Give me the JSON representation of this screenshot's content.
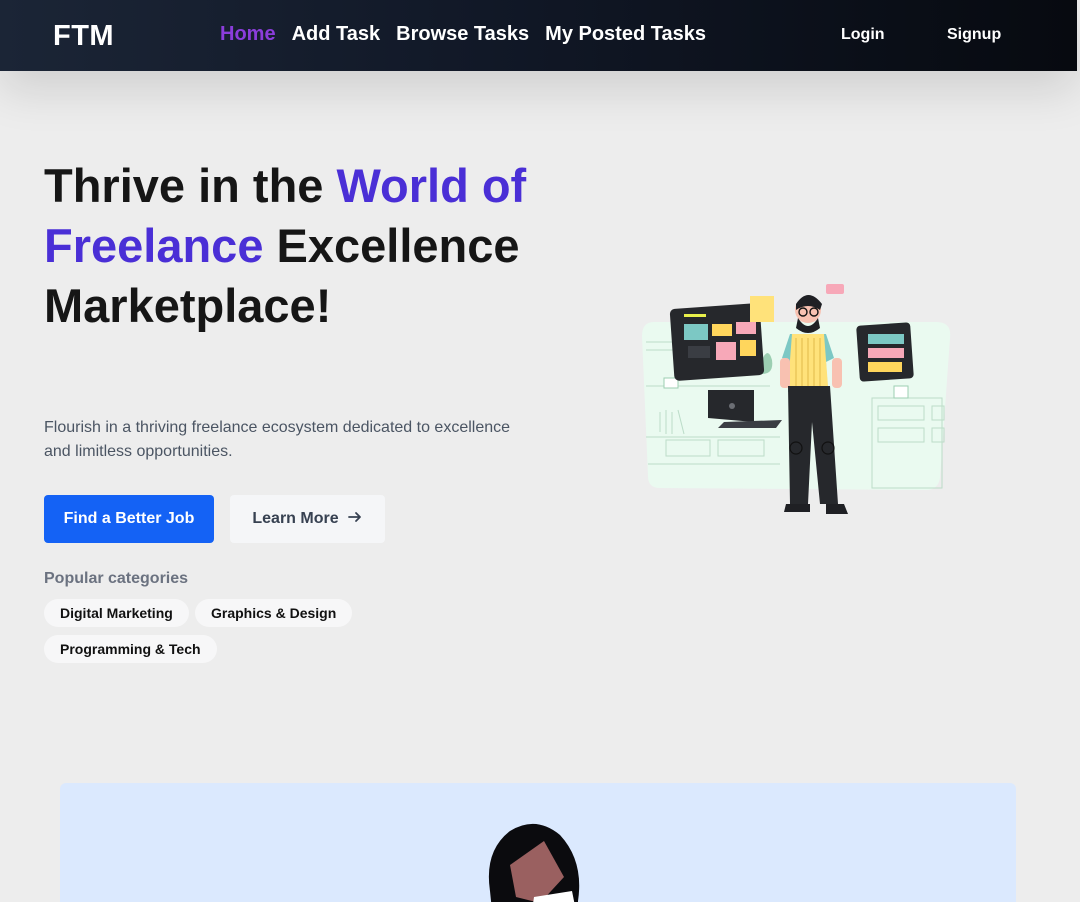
{
  "nav": {
    "logo": "FTM",
    "links": [
      {
        "label": "Home",
        "active": true
      },
      {
        "label": "Add Task",
        "active": false
      },
      {
        "label": "Browse Tasks",
        "active": false
      },
      {
        "label": "My Posted Tasks",
        "active": false
      }
    ],
    "login": "Login",
    "signup": "Signup"
  },
  "hero": {
    "title_part1": "Thrive in the ",
    "title_accent": "World of Freelance",
    "title_part2": " Excellence Marketplace!",
    "description": "Flourish in a thriving freelance ecosystem dedicated to excellence and limitless opportunities.",
    "primary_button": "Find a Better Job",
    "secondary_button": "Learn More",
    "categories_heading": "Popular categories",
    "categories": [
      "Digital Marketing",
      "Graphics & Design",
      "Programming & Tech"
    ]
  },
  "colors": {
    "accent": "#4a2fd6",
    "active_nav": "#8b3ddb",
    "primary_button": "#1462f5",
    "panel": "#dbe9fe"
  },
  "icons": {
    "learn_more": "arrow-right-icon"
  }
}
